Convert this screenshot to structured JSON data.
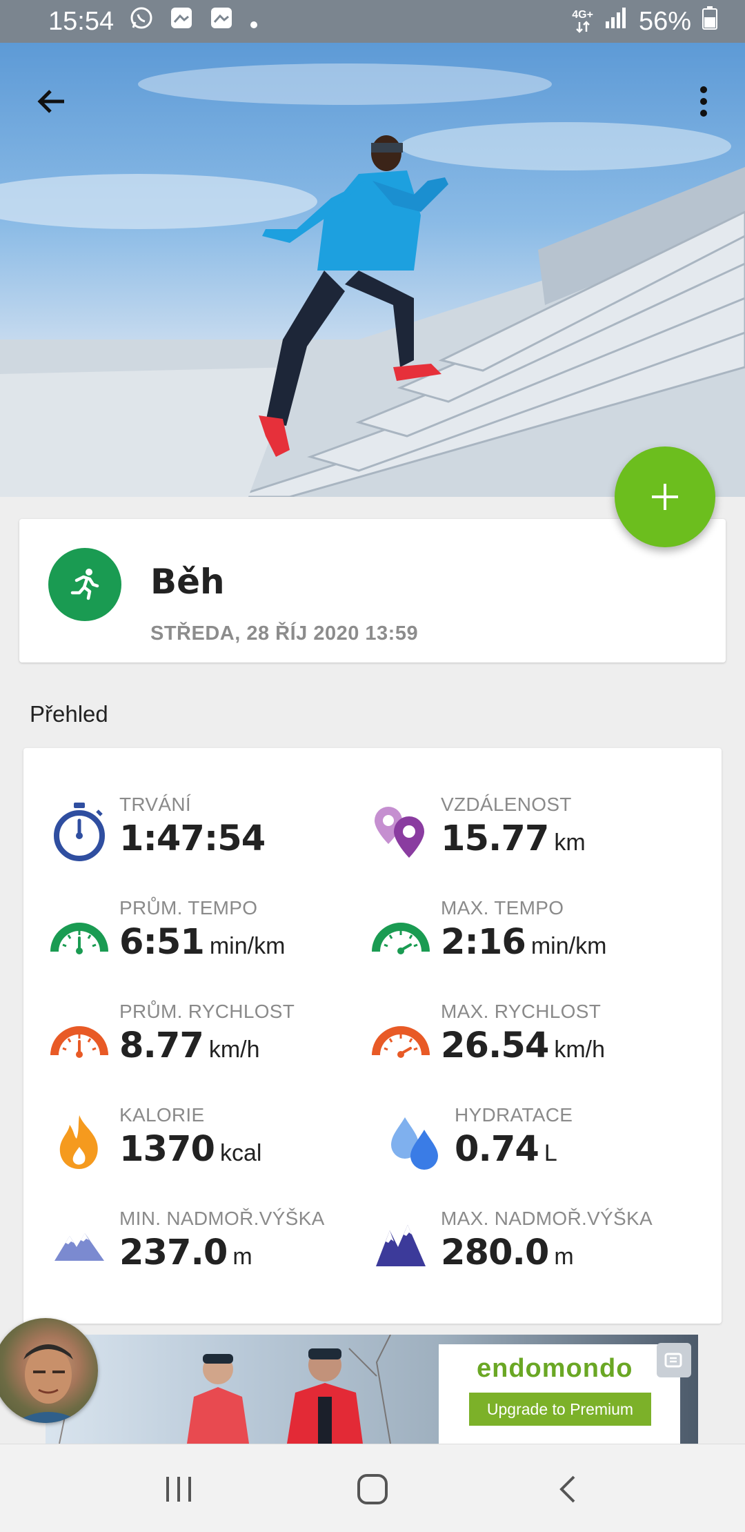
{
  "status_bar": {
    "time": "15:54",
    "network": "4G+",
    "battery": "56%",
    "notification_icons": [
      "whatsapp-icon",
      "gallery-icon",
      "gallery-icon",
      "dot-icon"
    ]
  },
  "header": {
    "back_icon": "arrow-left-icon",
    "menu_icon": "more-vertical-icon"
  },
  "fab": {
    "icon": "plus-icon",
    "color": "#6cbe1e"
  },
  "activity": {
    "sport": "Běh",
    "date": "STŘEDA, 28 ŘÍJ 2020 13:59",
    "icon": "running-icon",
    "icon_color": "#1a9b52"
  },
  "overview": {
    "title": "Přehled",
    "stats": [
      {
        "label": "TRVÁNÍ",
        "value": "1:47:54",
        "unit": "",
        "icon": "stopwatch-icon"
      },
      {
        "label": "VZDÁLENOST",
        "value": "15.77",
        "unit": "km",
        "icon": "location-pins-icon"
      },
      {
        "label": "PRŮM. TEMPO",
        "value": "6:51",
        "unit": "min/km",
        "icon": "green-gauge-icon"
      },
      {
        "label": "MAX. TEMPO",
        "value": "2:16",
        "unit": "min/km",
        "icon": "green-gauge-max-icon"
      },
      {
        "label": "PRŮM. RYCHLOST",
        "value": "8.77",
        "unit": "km/h",
        "icon": "orange-gauge-icon"
      },
      {
        "label": "MAX. RYCHLOST",
        "value": "26.54",
        "unit": "km/h",
        "icon": "orange-gauge-max-icon"
      },
      {
        "label": "KALORIE",
        "value": "1370",
        "unit": "kcal",
        "icon": "flame-icon"
      },
      {
        "label": "HYDRATACE",
        "value": "0.74",
        "unit": "L",
        "icon": "water-drops-icon"
      },
      {
        "label": "MIN. NADMOŘ.VÝŠKA",
        "value": "237.0",
        "unit": "m",
        "icon": "mountains-light-icon"
      },
      {
        "label": "MAX. NADMOŘ.VÝŠKA",
        "value": "280.0",
        "unit": "m",
        "icon": "mountains-dark-icon"
      }
    ]
  },
  "ad": {
    "brand": "endomondo",
    "button": "Upgrade to Premium"
  },
  "nav": {
    "recents_icon": "recents-icon",
    "home_icon": "home-icon",
    "back_icon": "back-chevron-icon"
  }
}
